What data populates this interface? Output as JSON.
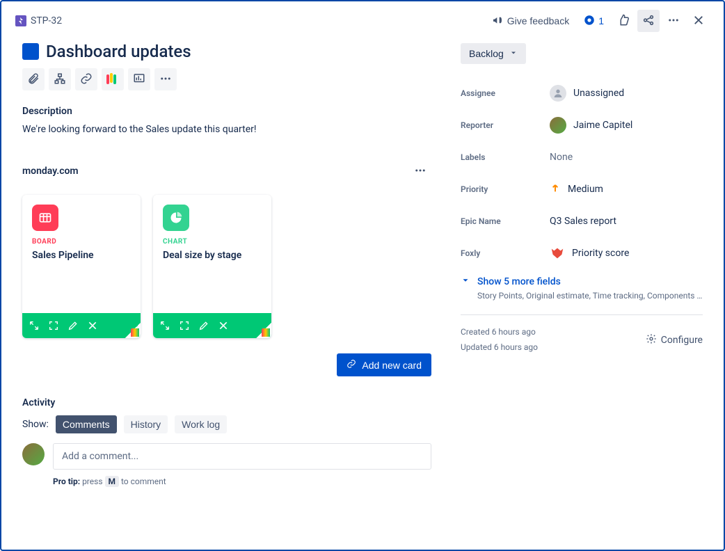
{
  "breadcrumb": {
    "issue_key": "STP-32"
  },
  "header": {
    "feedback": "Give feedback",
    "watchers": "1"
  },
  "issue": {
    "title": "Dashboard updates",
    "description_label": "Description",
    "description_text": "We're looking forward to the Sales update this quarter!"
  },
  "monday": {
    "section_title": "monday.com",
    "cards": [
      {
        "type_label": "BOARD",
        "title": "Sales Pipeline"
      },
      {
        "type_label": "CHART",
        "title": "Deal size by stage"
      }
    ],
    "add_card": "Add new card"
  },
  "activity": {
    "label": "Activity",
    "show": "Show:",
    "tabs": {
      "comments": "Comments",
      "history": "History",
      "worklog": "Work log"
    },
    "comment_placeholder": "Add a comment...",
    "protip_prefix": "Pro tip:",
    "protip_text_a": "press",
    "protip_key": "M",
    "protip_text_b": "to comment"
  },
  "sidebar": {
    "status": "Backlog",
    "fields": {
      "assignee_label": "Assignee",
      "assignee_value": "Unassigned",
      "reporter_label": "Reporter",
      "reporter_value": "Jaime Capitel",
      "labels_label": "Labels",
      "labels_value": "None",
      "priority_label": "Priority",
      "priority_value": "Medium",
      "epic_label": "Epic Name",
      "epic_value": "Q3 Sales report",
      "foxly_label": "Foxly",
      "foxly_value": "Priority score"
    },
    "show_more": "Show 5 more fields",
    "show_more_sub": "Story Points, Original estimate, Time tracking, Components and ...",
    "created": "Created 6 hours ago",
    "updated": "Updated 6 hours ago",
    "configure": "Configure"
  }
}
